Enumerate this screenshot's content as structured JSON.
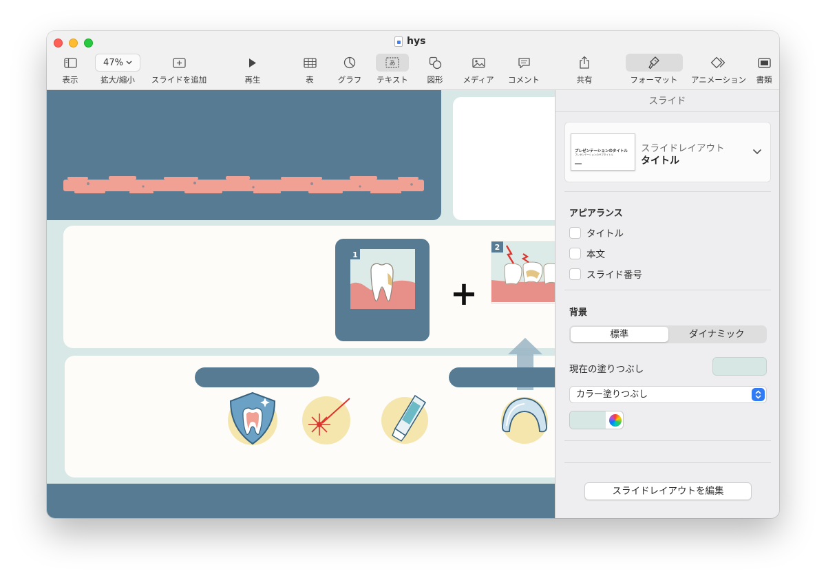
{
  "window": {
    "title": "hys"
  },
  "toolbar": {
    "view_label": "表示",
    "zoom_value": "47%",
    "zoom_label": "拡大/縮小",
    "add_slide_label": "スライドを追加",
    "play_label": "再生",
    "table_label": "表",
    "chart_label": "グラフ",
    "text_label": "テキスト",
    "shape_label": "図形",
    "media_label": "メディア",
    "comment_label": "コメント",
    "share_label": "共有",
    "format_label": "フォーマット",
    "animation_label": "アニメーション",
    "document_label": "書類"
  },
  "slide": {
    "badge_1": "1",
    "badge_2": "2",
    "plus": "+"
  },
  "inspector": {
    "tab": "スライド",
    "layout_heading": "スライドレイアウト",
    "layout_value": "タイトル",
    "thumb_title": "プレゼンテーションのタイトル",
    "thumb_subtitle": "プレゼンテーションのサブタイトル",
    "appearance_heading": "アピアランス",
    "appearance_items": [
      "タイトル",
      "本文",
      "スライド番号"
    ],
    "background_heading": "背景",
    "background_segments": [
      "標準",
      "ダイナミック"
    ],
    "current_fill_label": "現在の塗りつぶし",
    "fill_type": "カラー塗りつぶし",
    "edit_layout_button": "スライドレイアウトを編集"
  },
  "colors": {
    "slide_bg": "#d7e8e6",
    "navy": "#567b93",
    "salmon": "#f0a193",
    "fill_swatch": "#d6e7e4",
    "accent": "#2f7cf6"
  }
}
